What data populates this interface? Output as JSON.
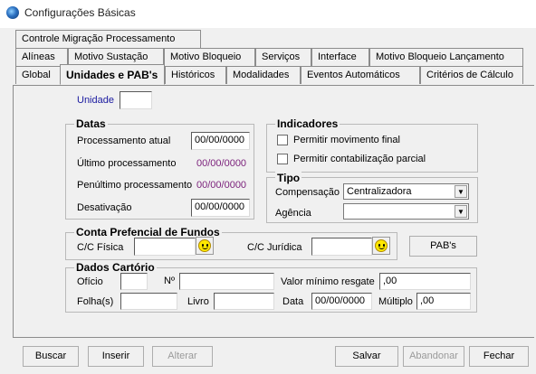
{
  "window": {
    "title": "Configurações Básicas"
  },
  "tabs": {
    "row1": [
      "Controle Migração Processamento"
    ],
    "row2": [
      "Alíneas",
      "Motivo Sustação",
      "Motivo Bloqueio",
      "Serviços",
      "Interface",
      "Motivo Bloqueio Lançamento"
    ],
    "row3": [
      "Global",
      "Unidades e PAB's",
      "Históricos",
      "Modalidades",
      "Eventos Automáticos",
      "Critérios de Cálculo"
    ],
    "active": "Unidades e PAB's"
  },
  "unidade": {
    "label": "Unidade",
    "value": ""
  },
  "datas": {
    "title": "Datas",
    "processamento_atual_label": "Processamento atual",
    "processamento_atual_value": "00/00/0000",
    "ultimo_processamento_label": "Último processamento",
    "ultimo_processamento_value": "00/00/0000",
    "penultimo_processamento_label": "Penúltimo processamento",
    "penultimo_processamento_value": "00/00/0000",
    "desativacao_label": "Desativação",
    "desativacao_value": "00/00/0000"
  },
  "indicadores": {
    "title": "Indicadores",
    "permitir_movimento_final": "Permitir movimento final",
    "permitir_contabilizacao_parcial": "Permitir contabilização parcial"
  },
  "tipo": {
    "title": "Tipo",
    "compensacao_label": "Compensação",
    "compensacao_value": "Centralizadora",
    "agencia_label": "Agência",
    "agencia_value": ""
  },
  "conta_prefencial": {
    "title": "Conta Prefencial de Fundos",
    "cc_fisica_label": "C/C Física",
    "cc_fisica_value": "",
    "cc_juridica_label": "C/C Jurídica",
    "cc_juridica_value": "",
    "pabs_button": "PAB's"
  },
  "dados_cartorio": {
    "title": "Dados Cartório",
    "oficio_label": "Ofício",
    "oficio_value": "",
    "n_label": "Nº",
    "n_value": "",
    "valor_minimo_label": "Valor mínimo resgate",
    "valor_minimo_value": ",00",
    "folhas_label": "Folha(s)",
    "folhas_value": "",
    "livro_label": "Livro",
    "livro_value": "",
    "data_label": "Data",
    "data_value": "00/00/0000",
    "multiplo_label": "Múltiplo",
    "multiplo_value": ",00"
  },
  "buttons": {
    "buscar": "Buscar",
    "inserir": "Inserir",
    "alterar": "Alterar",
    "salvar": "Salvar",
    "abandonar": "Abandonar",
    "fechar": "Fechar"
  }
}
